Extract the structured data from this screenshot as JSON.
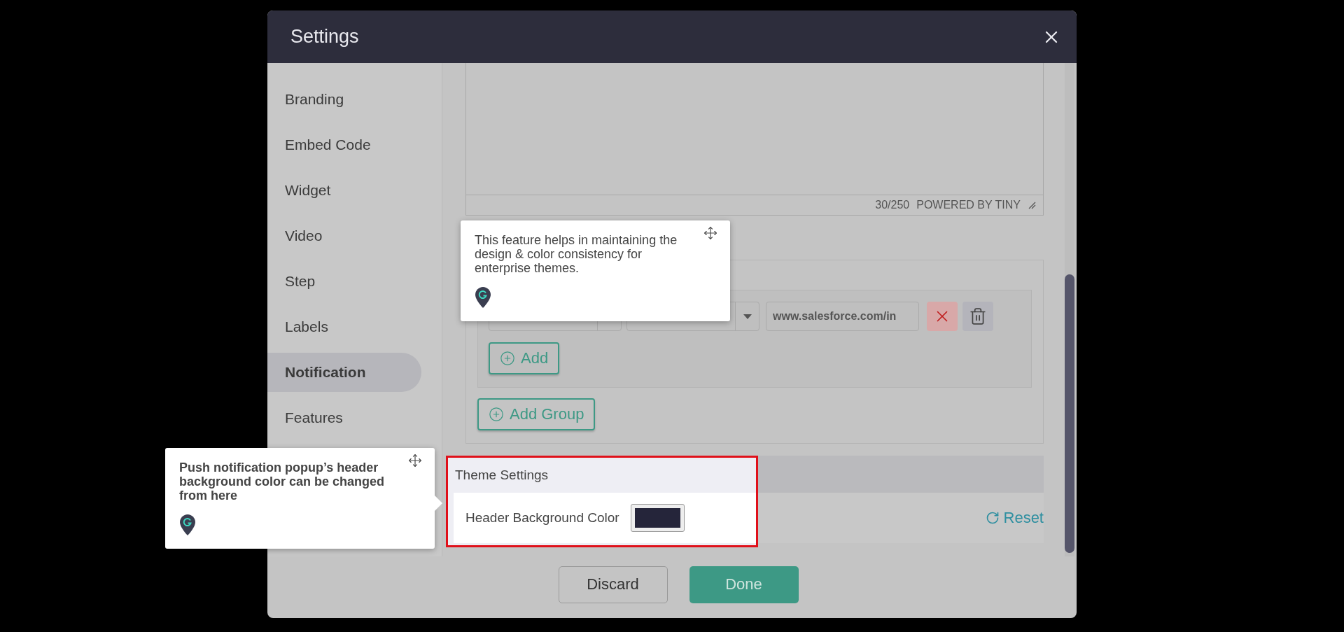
{
  "dialog": {
    "title": "Settings"
  },
  "sidebar": {
    "items": [
      {
        "label": "Branding",
        "selected": false
      },
      {
        "label": "Embed Code",
        "selected": false
      },
      {
        "label": "Widget",
        "selected": false
      },
      {
        "label": "Video",
        "selected": false
      },
      {
        "label": "Step",
        "selected": false
      },
      {
        "label": "Labels",
        "selected": false
      },
      {
        "label": "Notification",
        "selected": true
      },
      {
        "label": "Features",
        "selected": false
      }
    ]
  },
  "editor": {
    "counter": "30/250",
    "branding": "POWERED BY TINY"
  },
  "group": {
    "url": "www.salesforce.com/in",
    "add_button": "Add"
  },
  "add_group_button": "Add Group",
  "theme_settings": {
    "title": "Theme Settings",
    "label": "Header Background Color",
    "color": "#25253a",
    "reset": "Reset"
  },
  "footer": {
    "buttons": [
      {
        "label": "Discard",
        "kind": "secondary"
      },
      {
        "label": "Done",
        "kind": "primary"
      }
    ]
  },
  "tooltips": [
    {
      "text": "This feature helps in maintaining the design & color consistency for enterprise themes.",
      "bold": false
    },
    {
      "text": "Push notification popup’s header background color can be changed from here",
      "bold": true
    }
  ]
}
